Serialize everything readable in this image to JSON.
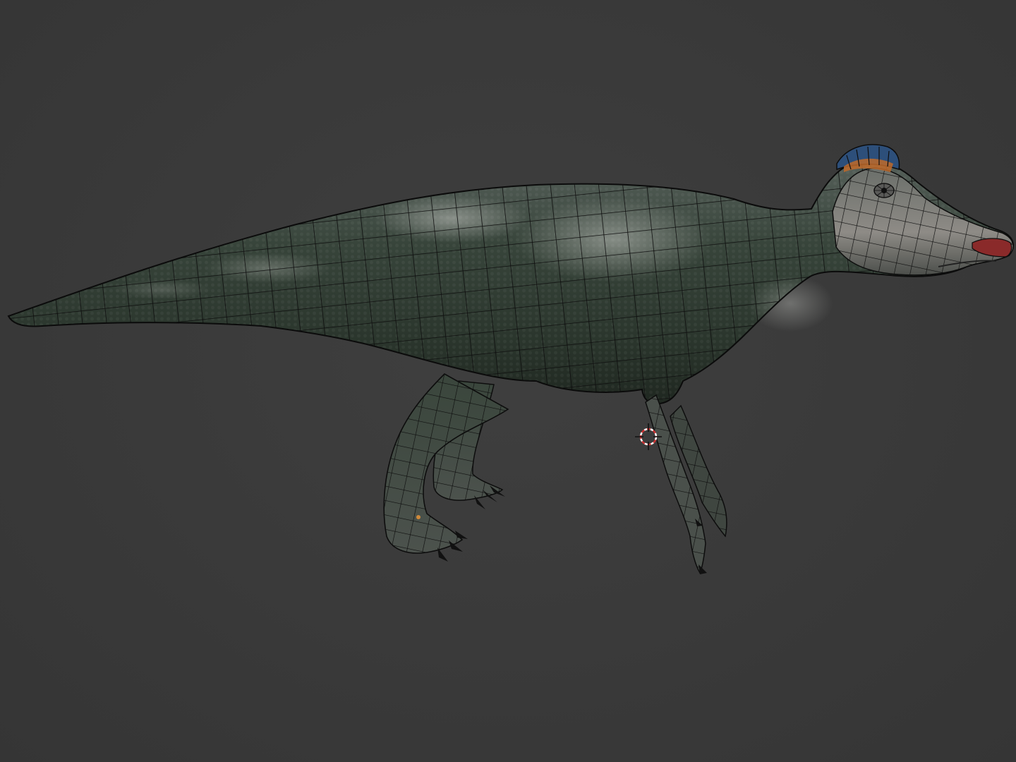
{
  "viewport": {
    "background_color": "#3a3a3a",
    "mode": "3d-viewport"
  },
  "model": {
    "name": "dinosaur-model",
    "shading": "textured-with-wireframe",
    "skin_color": "#2f3a2f",
    "highlight_color": "#a7aaa5",
    "crest_colors": [
      "#2d4f7a",
      "#c06a2a"
    ],
    "mouth_color": "#8a2a2a",
    "wire_color": "#111111"
  },
  "cursor": {
    "icon": "3d-cursor-icon",
    "color": "#cc3333"
  }
}
